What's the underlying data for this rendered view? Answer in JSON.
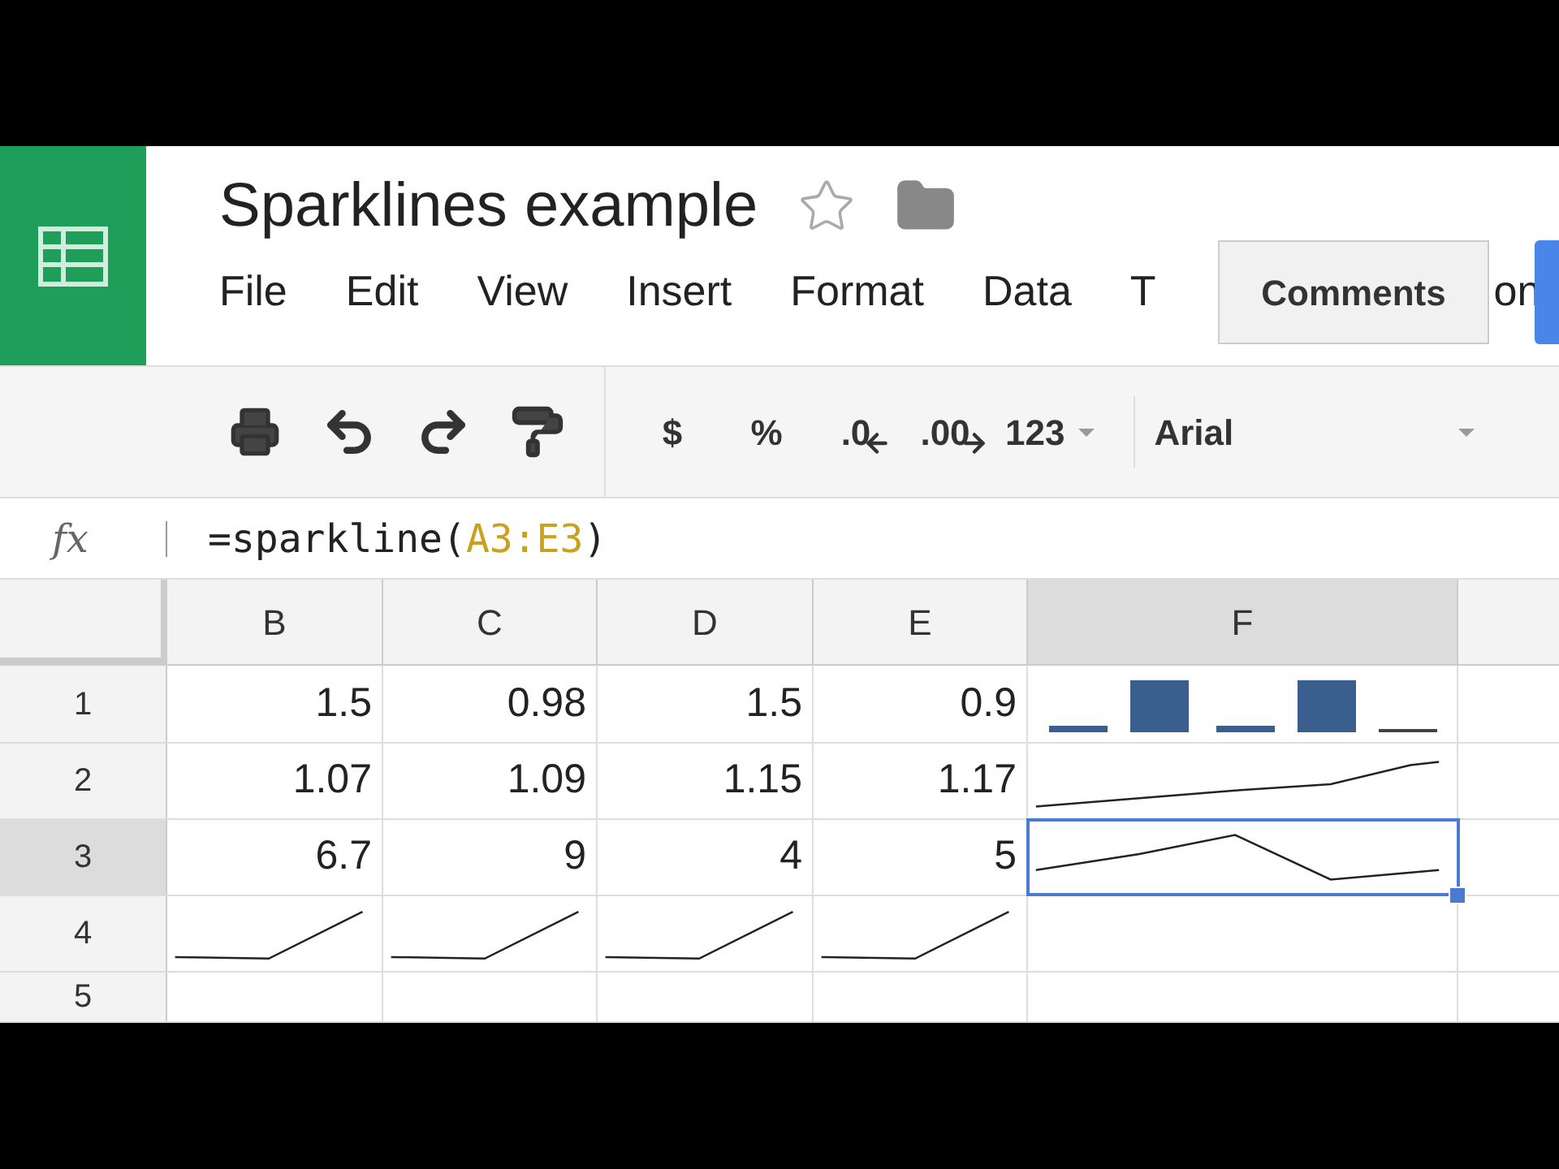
{
  "document": {
    "title": "Sparklines example",
    "starred": false
  },
  "menu": [
    {
      "label": "File"
    },
    {
      "label": "Edit"
    },
    {
      "label": "View"
    },
    {
      "label": "Insert"
    },
    {
      "label": "Format"
    },
    {
      "label": "Data"
    },
    {
      "label": "T"
    },
    {
      "label": "on"
    }
  ],
  "tooltip": "Comments",
  "toolbar": [
    {
      "kind": "print"
    },
    {
      "kind": "undo"
    },
    {
      "kind": "redo"
    },
    {
      "kind": "paint"
    },
    {
      "kind": "text",
      "label": "$"
    },
    {
      "kind": "text",
      "label": "%"
    },
    {
      "kind": "decrease",
      "label": ".0"
    },
    {
      "kind": "increase",
      "label": ".00"
    },
    {
      "kind": "dropdown",
      "label": "123"
    },
    {
      "kind": "font",
      "label": "Arial"
    }
  ],
  "formula_bar": {
    "label": "fx",
    "prefix": "=sparkline(",
    "range": "A3:E3",
    "suffix": ")"
  },
  "columns": [
    {
      "label": "B",
      "selected": false
    },
    {
      "label": "C",
      "selected": false
    },
    {
      "label": "D",
      "selected": false
    },
    {
      "label": "E",
      "selected": false
    },
    {
      "label": "F",
      "selected": true
    }
  ],
  "rows": [
    {
      "label": "1",
      "selected": false,
      "cells": [
        {
          "kind": "text",
          "text": "1.5",
          "selected": false
        },
        {
          "kind": "text",
          "text": "0.98",
          "selected": false
        },
        {
          "kind": "text",
          "text": "1.5",
          "selected": false
        },
        {
          "kind": "text",
          "text": "0.9",
          "selected": false
        },
        {
          "kind": "column-sparkline",
          "selected": false
        }
      ]
    },
    {
      "label": "2",
      "selected": false,
      "cells": [
        {
          "kind": "text",
          "text": "1.07",
          "selected": false
        },
        {
          "kind": "text",
          "text": "1.09",
          "selected": false
        },
        {
          "kind": "text",
          "text": "1.15",
          "selected": false
        },
        {
          "kind": "text",
          "text": "1.17",
          "selected": false
        },
        {
          "kind": "line-sparkline",
          "selected": false
        }
      ]
    },
    {
      "label": "3",
      "selected": true,
      "cells": [
        {
          "kind": "text",
          "text": "6.7",
          "selected": false
        },
        {
          "kind": "text",
          "text": "9",
          "selected": false
        },
        {
          "kind": "text",
          "text": "4",
          "selected": false
        },
        {
          "kind": "text",
          "text": "5",
          "selected": false
        },
        {
          "kind": "line-sparkline",
          "selected": true
        }
      ]
    },
    {
      "label": "4",
      "selected": false,
      "cells": [
        {
          "kind": "line-sparkline",
          "selected": false
        },
        {
          "kind": "line-sparkline",
          "selected": false
        },
        {
          "kind": "line-sparkline",
          "selected": false
        },
        {
          "kind": "line-sparkline",
          "selected": false
        },
        {
          "kind": "empty",
          "selected": false
        }
      ]
    },
    {
      "label": "5",
      "selected": false,
      "cells": [
        {
          "kind": "empty",
          "selected": false
        },
        {
          "kind": "empty",
          "selected": false
        },
        {
          "kind": "empty",
          "selected": false
        },
        {
          "kind": "empty",
          "selected": false
        },
        {
          "kind": "empty",
          "selected": false
        }
      ]
    }
  ]
}
